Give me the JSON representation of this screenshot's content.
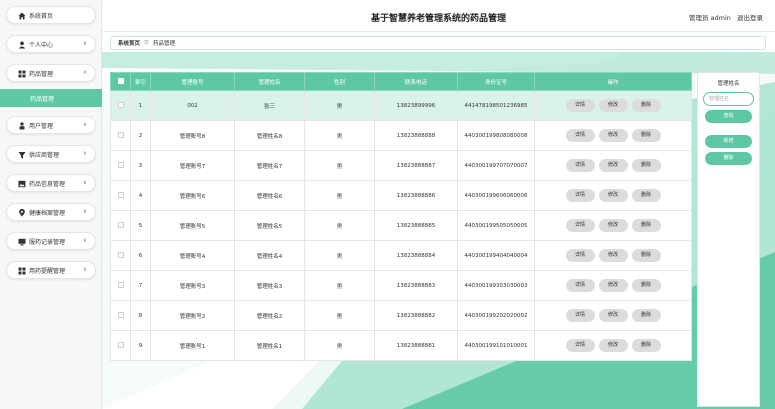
{
  "sidebar": {
    "items": [
      {
        "label": "系统首页",
        "icon": "home-icon",
        "caret": ""
      },
      {
        "label": "个人中心",
        "icon": "user-icon",
        "caret": "∨"
      },
      {
        "label": "药品管理",
        "icon": "grid-icon",
        "caret": "∧"
      },
      {
        "label": "用户管理",
        "icon": "person-icon",
        "caret": "∨"
      },
      {
        "label": "供应商管理",
        "icon": "filter-icon",
        "caret": "∨"
      },
      {
        "label": "药品信息管理",
        "icon": "image-icon",
        "caret": "∨"
      },
      {
        "label": "健康档案管理",
        "icon": "location-icon",
        "caret": "∨"
      },
      {
        "label": "服药记录管理",
        "icon": "monitor-icon",
        "caret": "∨"
      },
      {
        "label": "用药提醒管理",
        "icon": "grid-icon",
        "caret": "∨"
      }
    ],
    "active_sub": "药品管理"
  },
  "header": {
    "title": "基于智慧养老管理系统的药品管理",
    "user_text": "管理员 admin",
    "logout": "退出登录"
  },
  "breadcrumb": {
    "home": "系统首页",
    "sep": "☰",
    "current": "药品管理"
  },
  "table": {
    "columns": [
      "索引",
      "管理账号",
      "管理姓名",
      "性别",
      "联系电话",
      "身份证号",
      "操作"
    ],
    "actions": [
      "详情",
      "修改",
      "删除"
    ],
    "rows": [
      {
        "index": "1",
        "account": "002",
        "name": "张三",
        "gender": "男",
        "phone": "13823899996",
        "id_no": "441478198501236985"
      },
      {
        "index": "2",
        "account": "管理账号8",
        "name": "管理姓名8",
        "gender": "男",
        "phone": "13823888888",
        "id_no": "440300199808080008"
      },
      {
        "index": "3",
        "account": "管理账号7",
        "name": "管理姓名7",
        "gender": "男",
        "phone": "13823888887",
        "id_no": "440300199707070007"
      },
      {
        "index": "4",
        "account": "管理账号6",
        "name": "管理姓名6",
        "gender": "男",
        "phone": "13823888886",
        "id_no": "440300199606060006"
      },
      {
        "index": "5",
        "account": "管理账号5",
        "name": "管理姓名5",
        "gender": "男",
        "phone": "13823888885",
        "id_no": "440300199505050005"
      },
      {
        "index": "6",
        "account": "管理账号4",
        "name": "管理姓名4",
        "gender": "男",
        "phone": "13823888884",
        "id_no": "440300199404040004"
      },
      {
        "index": "7",
        "account": "管理账号3",
        "name": "管理姓名3",
        "gender": "男",
        "phone": "13823888883",
        "id_no": "440300199303030003"
      },
      {
        "index": "8",
        "account": "管理账号2",
        "name": "管理姓名2",
        "gender": "男",
        "phone": "13823888882",
        "id_no": "440300199202020002"
      },
      {
        "index": "9",
        "account": "管理账号1",
        "name": "管理姓名1",
        "gender": "男",
        "phone": "13823888881",
        "id_no": "440300199101010001"
      }
    ]
  },
  "search": {
    "title": "管理姓名",
    "placeholder": "管理姓名",
    "search_label": "查询",
    "add_label": "新增",
    "delete_label": "删除"
  },
  "colors": {
    "accent": "#5ec8a2",
    "accent_dark": "#3fb58a",
    "selected_row": "#d9f3ea"
  }
}
